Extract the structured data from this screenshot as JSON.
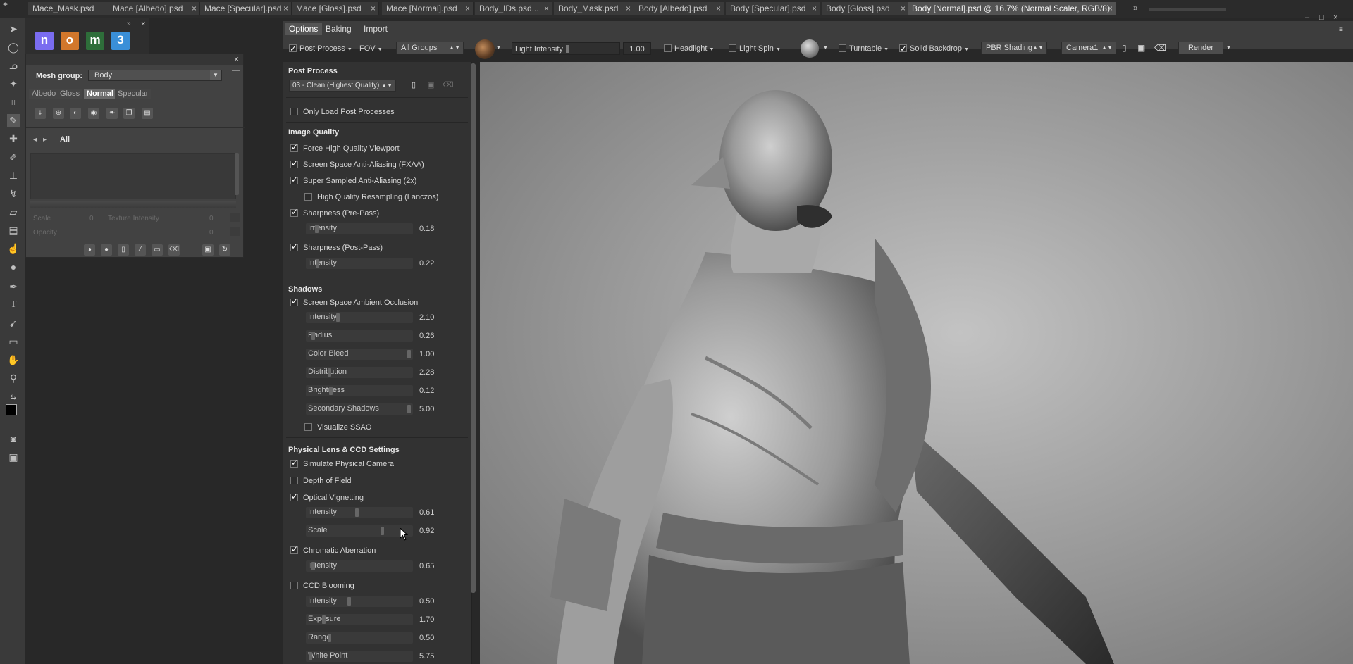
{
  "document_tabs": [
    {
      "label": "Mace_Mask.psd",
      "active": false
    },
    {
      "label": "Mace [Albedo].psd",
      "active": false
    },
    {
      "label": "Mace [Specular].psd",
      "active": false
    },
    {
      "label": "Mace [Gloss].psd",
      "active": false
    },
    {
      "label": "Mace [Normal].psd",
      "active": false
    },
    {
      "label": "Body_IDs.psd...",
      "active": false
    },
    {
      "label": "Body_Mask.psd",
      "active": false
    },
    {
      "label": "Body [Albedo].psd",
      "active": false
    },
    {
      "label": "Body [Specular].psd",
      "active": false
    },
    {
      "label": "Body [Gloss].psd",
      "active": false
    },
    {
      "label": "Body [Normal].psd @ 16.7% (Normal Scaler, RGB/8)",
      "active": true
    }
  ],
  "tab_close_glyph": "×",
  "tabs_overflow_glyph": "»",
  "window_controls": {
    "minimize": "‒",
    "maximize": "□",
    "close": "×"
  },
  "app_icons": [
    {
      "letter": "n",
      "color": "#7a6cf0"
    },
    {
      "letter": "o",
      "color": "#d2772b"
    },
    {
      "letter": "m",
      "color": "#2e6e3a"
    },
    {
      "letter": "3",
      "color": "#3a8fd8"
    }
  ],
  "mesh_panel": {
    "mesh_group_label": "Mesh group:",
    "mesh_group_value": "Body",
    "channel_tabs": [
      {
        "label": "Albedo",
        "active": false
      },
      {
        "label": "Gloss",
        "active": false
      },
      {
        "label": "Normal",
        "active": true
      },
      {
        "label": "Specular",
        "active": false
      }
    ],
    "layer_filter": "All",
    "scale_label": "Scale",
    "scale_value": "0",
    "texture_intensity_label": "Texture Intensity",
    "texture_intensity_value": "0",
    "opacity_label": "Opacity",
    "opacity_value": "0"
  },
  "toolbar": {
    "tabs": [
      {
        "label": "Options",
        "active": true
      },
      {
        "label": "Baking",
        "active": false
      },
      {
        "label": "Import",
        "active": false
      }
    ],
    "post_process": {
      "label": "Post Process",
      "checked": true
    },
    "fov_label": "FOV",
    "groups_value": "All Groups",
    "light_intensity_label": "Light Intensity",
    "light_intensity_value": "1.00",
    "light_intensity_level": 0.0,
    "headlight": {
      "label": "Headlight",
      "checked": false
    },
    "light_spin": {
      "label": "Light Spin",
      "checked": false
    },
    "turntable": {
      "label": "Turntable",
      "checked": false
    },
    "solid_backdrop": {
      "label": "Solid Backdrop",
      "checked": true
    },
    "shading_value": "PBR Shading",
    "camera_value": "Camera1",
    "render_label": "Render"
  },
  "options": {
    "post_process_header": "Post Process",
    "preset_value": "03 - Clean (Highest Quality)",
    "only_load": {
      "label": "Only Load Post Processes",
      "checked": false
    },
    "image_quality_header": "Image Quality",
    "force_hq": {
      "label": "Force High Quality Viewport",
      "checked": true
    },
    "fxaa": {
      "label": "Screen Space Anti-Aliasing (FXAA)",
      "checked": true
    },
    "ssaa": {
      "label": "Super Sampled Anti-Aliasing (2x)",
      "checked": true
    },
    "lanczos": {
      "label": "High Quality Resampling (Lanczos)",
      "checked": false
    },
    "sharp_pre": {
      "label": "Sharpness (Pre-Pass)",
      "checked": true
    },
    "sharp_pre_intensity": {
      "label": "Intensity",
      "value": "0.18",
      "level": 0.06
    },
    "sharp_post": {
      "label": "Sharpness (Post-Pass)",
      "checked": true
    },
    "sharp_post_intensity": {
      "label": "Intensity",
      "value": "0.22",
      "level": 0.07
    },
    "shadows_header": "Shadows",
    "ssao": {
      "label": "Screen Space Ambient Occlusion",
      "checked": true
    },
    "ssao_sliders": [
      {
        "label": "Intensity",
        "value": "2.10",
        "level": 0.27
      },
      {
        "label": "Radius",
        "value": "0.26",
        "level": 0.03
      },
      {
        "label": "Color Bleed",
        "value": "1.00",
        "level": 0.97
      },
      {
        "label": "Distribution",
        "value": "2.28",
        "level": 0.19
      },
      {
        "label": "Brightness",
        "value": "0.12",
        "level": 0.2
      },
      {
        "label": "Secondary Shadows",
        "value": "5.00",
        "level": 0.97
      }
    ],
    "visualize_ssao": {
      "label": "Visualize SSAO",
      "checked": false
    },
    "lens_header": "Physical Lens & CCD Settings",
    "simulate_camera": {
      "label": "Simulate Physical Camera",
      "checked": true
    },
    "dof": {
      "label": "Depth of Field",
      "checked": false
    },
    "vignetting": {
      "label": "Optical Vignetting",
      "checked": true
    },
    "vignetting_sliders": [
      {
        "label": "Intensity",
        "value": "0.61",
        "level": 0.46
      },
      {
        "label": "Scale",
        "value": "0.92",
        "level": 0.71
      }
    ],
    "chromatic": {
      "label": "Chromatic Aberration",
      "checked": true
    },
    "chromatic_intensity": {
      "label": "Intensity",
      "value": "0.65",
      "level": 0.03
    },
    "ccd_blooming": {
      "label": "CCD Blooming",
      "checked": false
    },
    "blooming_sliders": [
      {
        "label": "Intensity",
        "value": "0.50",
        "level": 0.38
      },
      {
        "label": "Exposure",
        "value": "1.70",
        "level": 0.13
      },
      {
        "label": "Range",
        "value": "0.50",
        "level": 0.19
      },
      {
        "label": "White Point",
        "value": "5.75",
        "level": 0.0
      }
    ]
  }
}
